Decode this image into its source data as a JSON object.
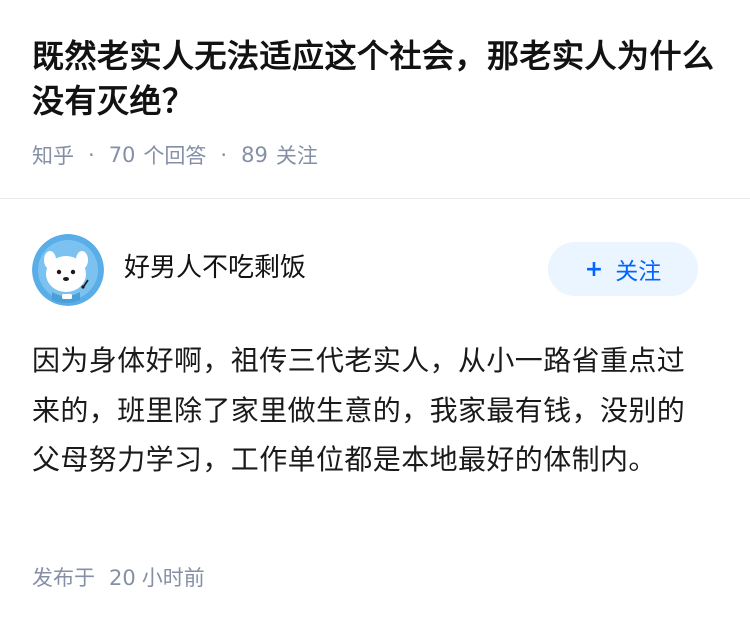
{
  "question": {
    "title": "既然老实人无法适应这个社会，那老实人为什么没有灭绝？",
    "source": "知乎",
    "separator": "·",
    "answer_count": "70",
    "answer_label": "个回答",
    "follow_count": "89",
    "follow_label": "关注"
  },
  "answer": {
    "author_name": "好男人不吃剩饭",
    "follow_button_icon": "+",
    "follow_button_label": "关注",
    "content": "因为身体好啊，祖传三代老实人，从小一路省重点过来的，班里除了家里做生意的，我家最有钱，没别的父母努力学习，工作单位都是本地最好的体制内。",
    "time_prefix": "发布于",
    "time_value": "20",
    "time_unit": "小时前"
  },
  "colors": {
    "accent": "#0066ff",
    "button_bg": "#ebf5ff",
    "meta_text": "#8590a6",
    "avatar_bg": "#5aaee8"
  },
  "icons": {
    "avatar": "cartoon-dog-avatar-icon",
    "follow": "plus-icon"
  }
}
